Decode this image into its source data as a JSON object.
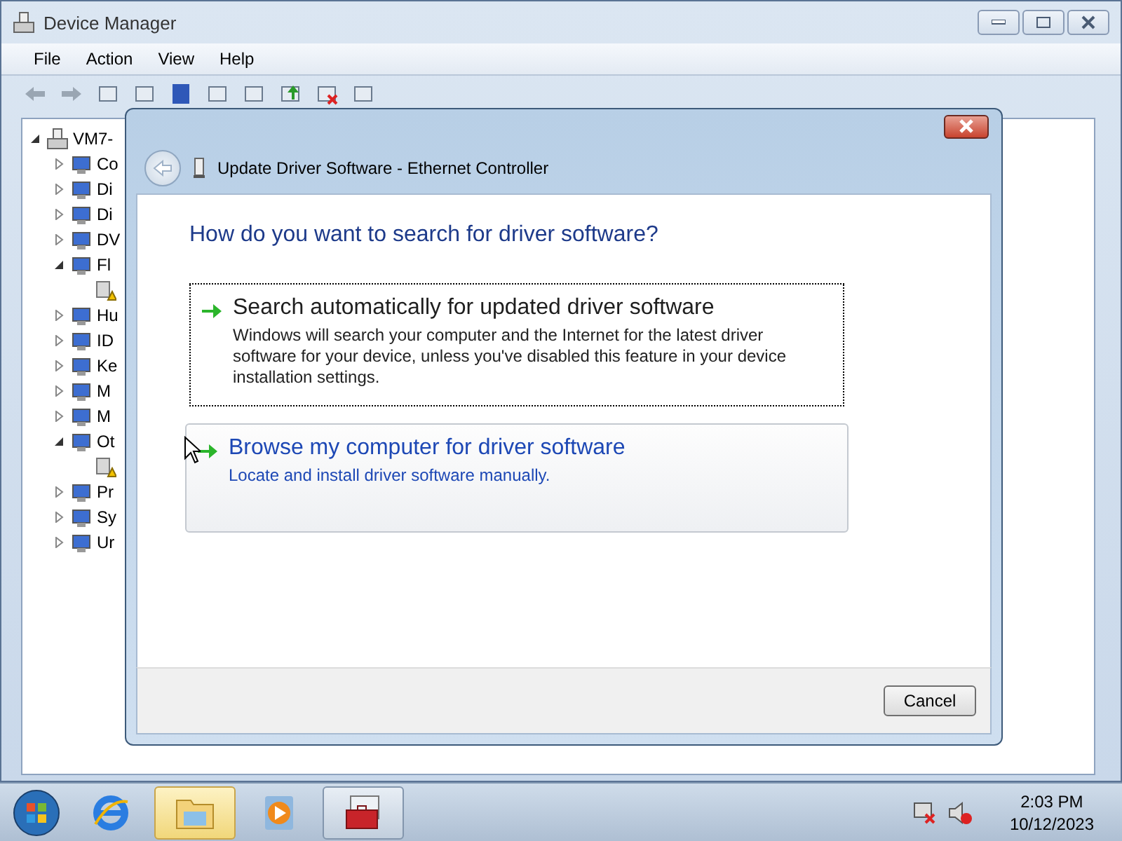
{
  "window": {
    "title": "Device Manager"
  },
  "menu": [
    "File",
    "Action",
    "View",
    "Help"
  ],
  "tree": [
    {
      "label": "VM7-",
      "kind": "computer",
      "expanded": true,
      "children": [
        {
          "label": "Co",
          "kind": "device",
          "expanded": false
        },
        {
          "label": "Di",
          "kind": "device",
          "expanded": false
        },
        {
          "label": "Di",
          "kind": "device",
          "expanded": false
        },
        {
          "label": "DV",
          "kind": "device",
          "expanded": false
        },
        {
          "label": "Fl",
          "kind": "device",
          "expanded": true,
          "children": [
            {
              "kind": "warning"
            }
          ]
        },
        {
          "label": "Hu",
          "kind": "device",
          "expanded": false
        },
        {
          "label": "ID",
          "kind": "device",
          "expanded": false
        },
        {
          "label": "Ke",
          "kind": "device",
          "expanded": false
        },
        {
          "label": "M",
          "kind": "device",
          "expanded": false
        },
        {
          "label": "M",
          "kind": "device",
          "expanded": false
        },
        {
          "label": "Ot",
          "kind": "device",
          "expanded": true,
          "children": [
            {
              "kind": "warning"
            }
          ]
        },
        {
          "label": "Pr",
          "kind": "device",
          "expanded": false
        },
        {
          "label": "Sy",
          "kind": "device",
          "expanded": false
        },
        {
          "label": "Ur",
          "kind": "device",
          "expanded": false
        }
      ]
    }
  ],
  "dialog": {
    "title": "Update Driver Software - Ethernet Controller",
    "question": "How do you want to search for driver software?",
    "options": [
      {
        "title": "Search automatically for updated driver software",
        "description": "Windows will search your computer and the Internet for the latest driver software for your device, unless you've disabled this feature in your device installation settings.",
        "focused": true,
        "hovered": false
      },
      {
        "title": "Browse my computer for driver software",
        "description": "Locate and install driver software manually.",
        "focused": false,
        "hovered": true
      }
    ],
    "cancel": "Cancel"
  },
  "taskbar": {
    "items": [
      {
        "kind": "browser",
        "highlighted": false,
        "active": false
      },
      {
        "kind": "folder",
        "highlighted": true,
        "active": false
      },
      {
        "kind": "media",
        "highlighted": false,
        "active": false
      },
      {
        "kind": "toolbox",
        "highlighted": false,
        "active": true
      }
    ],
    "time": "2:03 PM",
    "date": "10/12/2023"
  }
}
